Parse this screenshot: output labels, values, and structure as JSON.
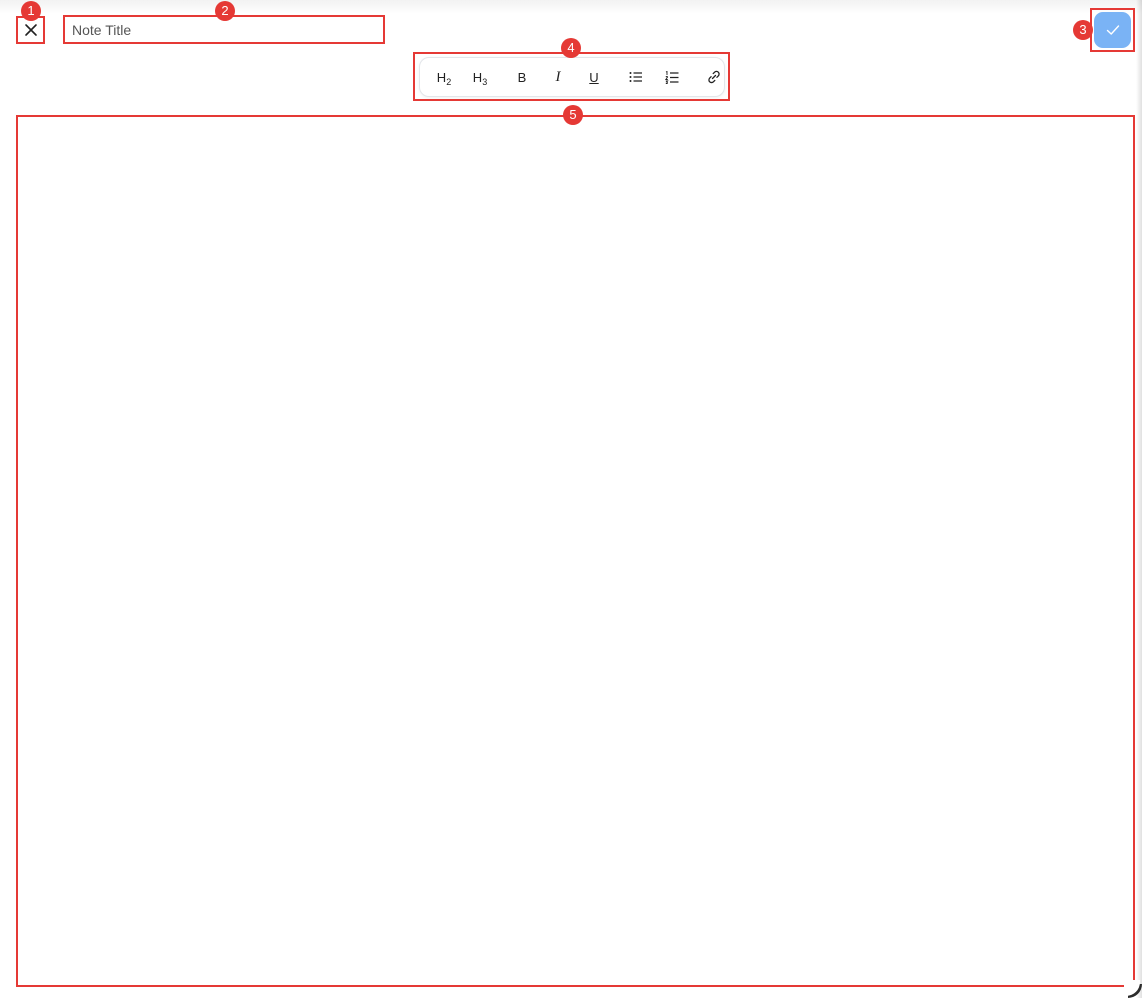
{
  "header": {
    "close_icon": "close-icon",
    "title_input": {
      "value": "",
      "placeholder": "Note Title"
    },
    "save_icon": "check-icon"
  },
  "toolbar": {
    "items": [
      {
        "icon": "heading-2-icon",
        "label": "H",
        "sub": "2"
      },
      {
        "icon": "heading-3-icon",
        "label": "H",
        "sub": "3"
      },
      {
        "icon": "bold-icon",
        "label": "B"
      },
      {
        "icon": "italic-icon",
        "label": "I"
      },
      {
        "icon": "underline-icon",
        "label": "U"
      },
      {
        "icon": "bullet-list-icon"
      },
      {
        "icon": "numbered-list-icon"
      },
      {
        "icon": "link-icon"
      }
    ]
  },
  "editor": {
    "content": ""
  },
  "annotations": {
    "badges": [
      "1",
      "2",
      "3",
      "4",
      "5"
    ]
  },
  "colors": {
    "accent": "#7ab3f5",
    "annotation": "#e53935"
  }
}
